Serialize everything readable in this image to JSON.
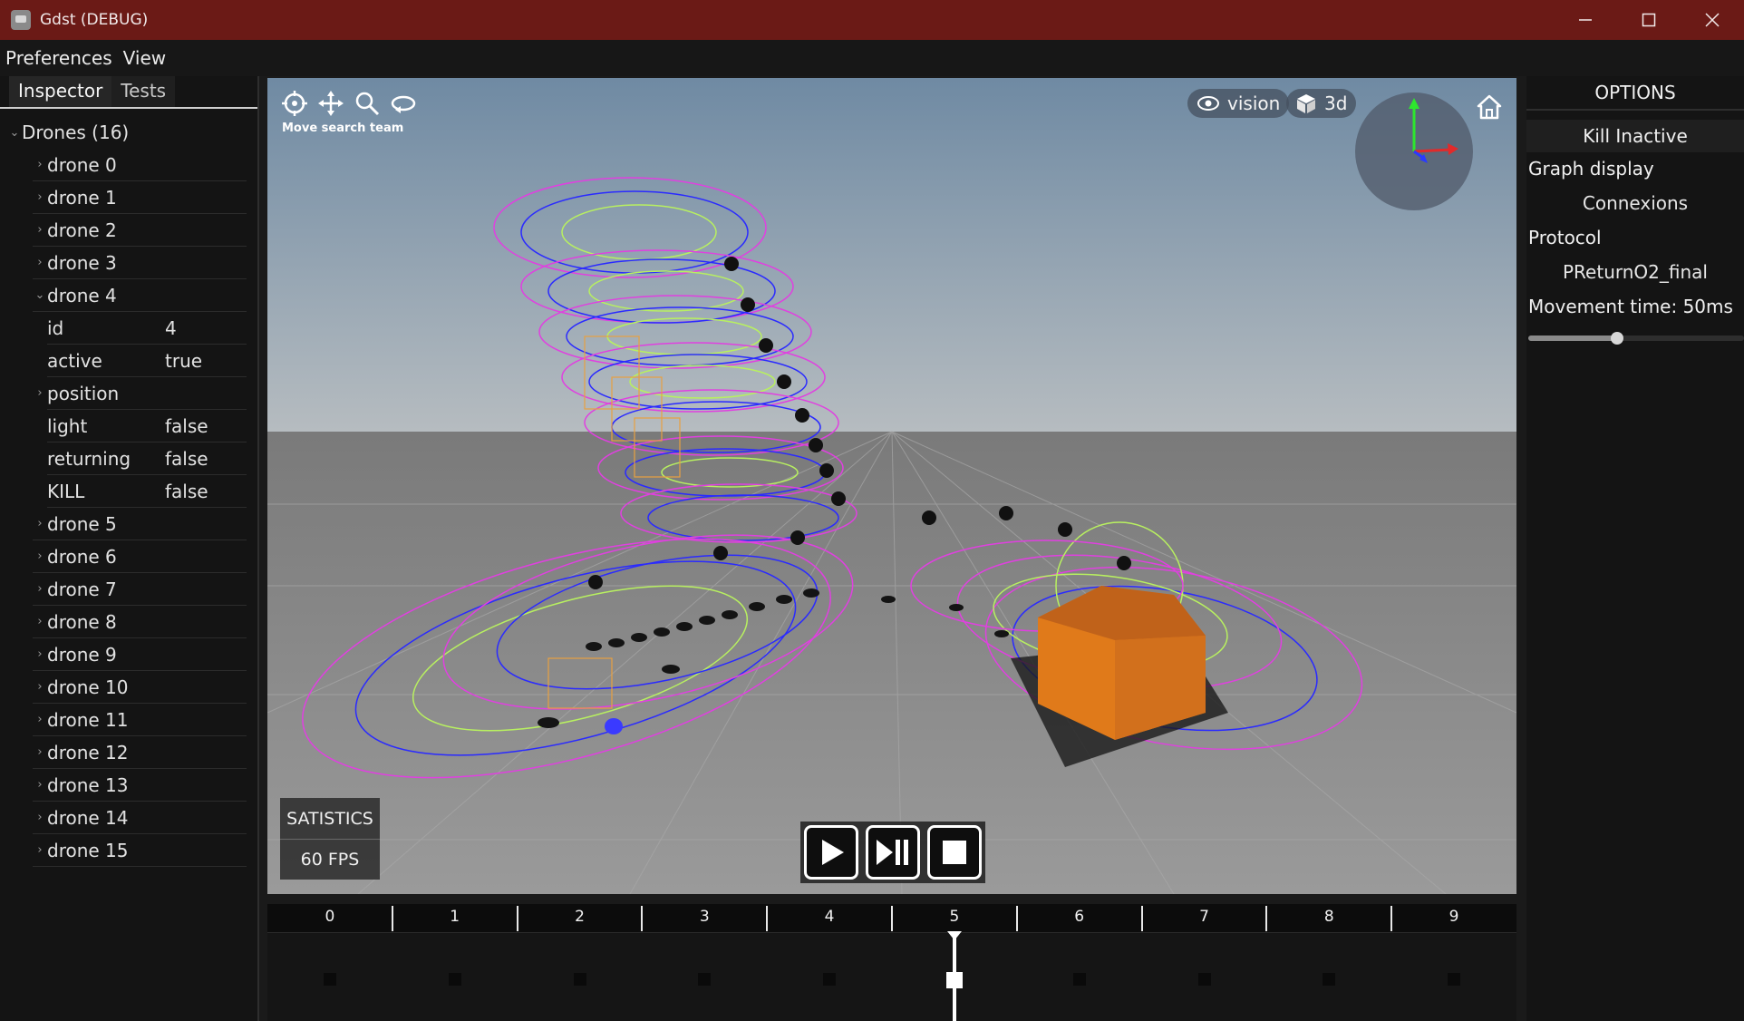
{
  "window": {
    "title": "Gdst (DEBUG)"
  },
  "menu": {
    "items": [
      "Preferences",
      "View"
    ]
  },
  "inspector": {
    "tabs": [
      "Inspector",
      "Tests"
    ],
    "root_label": "Drones (16)",
    "drones": [
      "drone 0",
      "drone 1",
      "drone 2",
      "drone 3",
      "drone 4",
      "drone 5",
      "drone 6",
      "drone 7",
      "drone 8",
      "drone 9",
      "drone 10",
      "drone 11",
      "drone 12",
      "drone 13",
      "drone 14",
      "drone 15"
    ],
    "expanded_index": 4,
    "properties": [
      {
        "key": "id",
        "value": "4"
      },
      {
        "key": "active",
        "value": "true"
      },
      {
        "key": "position",
        "value": ""
      },
      {
        "key": "light",
        "value": "false"
      },
      {
        "key": "returning",
        "value": "false"
      },
      {
        "key": "KILL",
        "value": "false"
      }
    ]
  },
  "viewport": {
    "tool_caption": "Move search team",
    "tools": [
      "crosshair-icon",
      "move-icon",
      "search-icon",
      "orbit-icon"
    ],
    "vision_label": "vision",
    "mode_label": "3d",
    "stats_title": "SATISTICS",
    "fps": "60 FPS",
    "colors": {
      "sky_top": "#6f8aa3",
      "sky_horizon": "#b6bcc0",
      "floor": "#8f8f8f",
      "magenta": "#e040e0",
      "blue": "#2a2aff",
      "green": "#b8f060",
      "box": "#e07a1a"
    }
  },
  "timeline": {
    "ticks": [
      "0",
      "1",
      "2",
      "3",
      "4",
      "5",
      "6",
      "7",
      "8",
      "9"
    ],
    "current": 5
  },
  "options": {
    "header": "OPTIONS",
    "kill_button": "Kill Inactive",
    "graph_label": "Graph display",
    "graph_value": "Connexions",
    "protocol_label": "Protocol",
    "protocol_value": "PReturnO2_final",
    "movement_label": "Movement time: 50ms",
    "movement_fraction": 0.41
  }
}
